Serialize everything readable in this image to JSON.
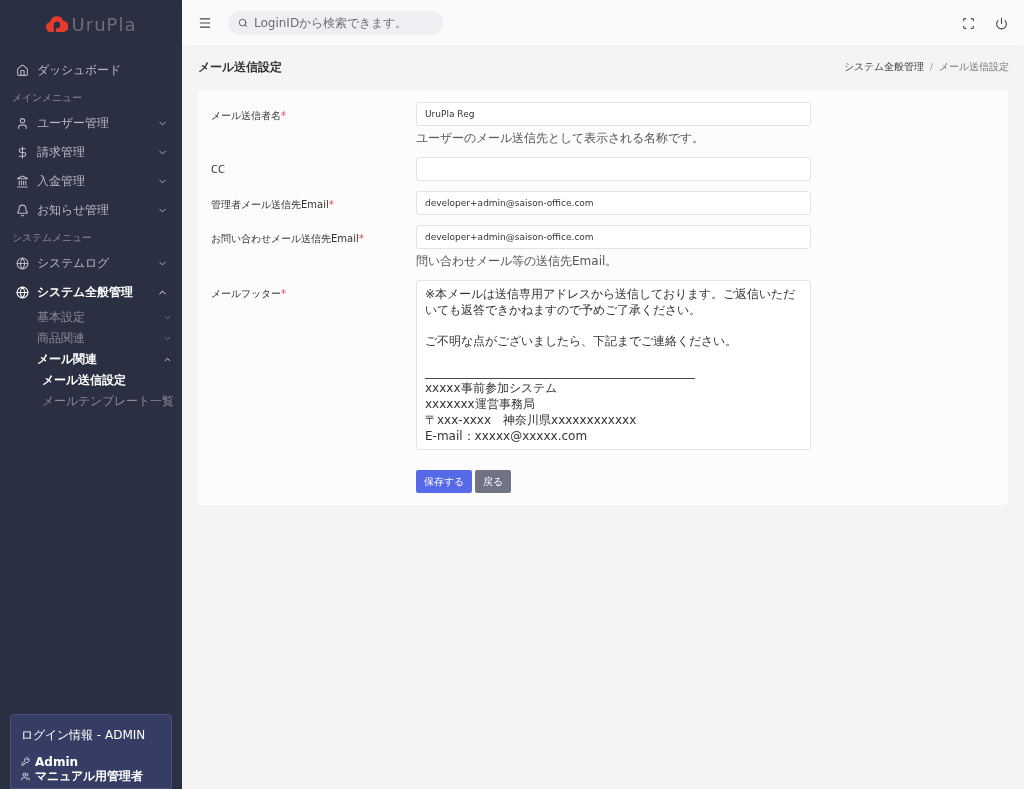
{
  "sidebar": {
    "logo": "UruPla",
    "nav": [
      {
        "kind": "link",
        "label": "ダッシュボード"
      },
      {
        "kind": "heading",
        "label": "メインメニュー"
      },
      {
        "kind": "group",
        "label": "ユーザー管理",
        "expanded": false
      },
      {
        "kind": "group",
        "label": "請求管理",
        "expanded": false
      },
      {
        "kind": "group",
        "label": "入金管理",
        "expanded": false
      },
      {
        "kind": "group",
        "label": "お知らせ管理",
        "expanded": false
      },
      {
        "kind": "heading",
        "label": "システムメニュー"
      },
      {
        "kind": "group",
        "label": "システムログ",
        "expanded": false
      },
      {
        "kind": "group",
        "label": "システム全般管理",
        "expanded": true,
        "children": [
          {
            "label": "基本設定",
            "expanded": false
          },
          {
            "label": "商品関連",
            "expanded": false
          },
          {
            "label": "メール関連",
            "expanded": true,
            "children": [
              {
                "label": "メール送信設定",
                "selected": true
              },
              {
                "label": "メールテンプレート一覧",
                "selected": false
              }
            ]
          }
        ]
      }
    ],
    "login_box": {
      "title": "ログイン情報 - ADMIN",
      "lines": [
        "Admin",
        "マニュアル用管理者"
      ]
    }
  },
  "topbar": {
    "search": {
      "placeholder": "LoginIDから検索できます。"
    }
  },
  "page": {
    "title": "メール送信設定",
    "breadcrumb": [
      {
        "label": "システム全般管理",
        "selected": false
      },
      {
        "label": "メール送信設定",
        "selected": true
      }
    ],
    "breadcrumb_separator": "/"
  },
  "form": {
    "fields": [
      {
        "kind": "input",
        "label": "メール送信者名",
        "required": true,
        "value": "UruPla Reg",
        "help": "ユーザーのメール送信先として表示される名称です。"
      },
      {
        "kind": "input",
        "label": "CC",
        "required": false
      },
      {
        "kind": "input",
        "label": "管理者メール送信先Email",
        "required": true,
        "value": "developer+admin@saison-office.com"
      },
      {
        "kind": "input",
        "label": "お問い合わせメール送信先Email",
        "required": true,
        "value": "developer+admin@saison-office.com",
        "help": "問い合わせメール等の送信先Email。"
      },
      {
        "kind": "textarea",
        "label": "メールフッター",
        "required": true,
        "paragraphs": [
          [
            "※本メールは送信専用アドレスから送信しております。ご返信いただいても返答できかねますので予めご了承ください。"
          ],
          [
            "ご不明な点がございましたら、下記までご連絡ください。"
          ],
          [
            "_____________________________________________",
            "xxxxx事前参加システム",
            "xxxxxxx運営事務局",
            "〒xxx-xxxx　神奈川県xxxxxxxxxxxx",
            "E-mail：xxxxx@xxxxx.com"
          ]
        ]
      }
    ],
    "required_mark": "*",
    "buttons": [
      {
        "kind": "primary",
        "label": "保存する"
      },
      {
        "kind": "secondary",
        "label": "戻る"
      }
    ]
  }
}
